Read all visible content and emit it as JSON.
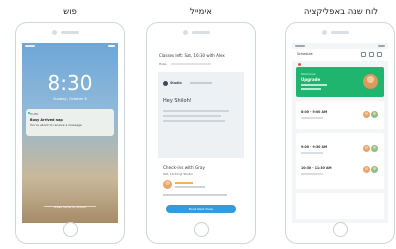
{
  "labels": {
    "app_screen": "לוח שנה באפליקציה",
    "email": "אימייל",
    "push": "פוש"
  },
  "push_phone": {
    "time": "8:30",
    "date": "Sunday, October 8",
    "notification_app": "HUBS",
    "notification_title": "Busy Arrived nap",
    "notification_body": "You're about to receive a message",
    "unlock_text": "Press home to unlock"
  },
  "email_phone": {
    "subject": "Classes left: Sat, 16:30 with Alex",
    "from": "Hubs",
    "brand": "Studio",
    "greeting": "Hey Shiloh!",
    "inner_title": "Check-ins with Gray",
    "inner_sub": "Sat, 16:30 @ Studio",
    "cta": "Book Next Class"
  },
  "app_phone": {
    "title": "Schedule",
    "featured_sub": "Tomorrow",
    "featured_title": "Upgrade",
    "slots": [
      {
        "time": "8:00 - 9:00 AM"
      },
      {
        "time": "9:00 - 9:30 AM"
      },
      {
        "time": "10:30 - 11:30 AM"
      }
    ]
  },
  "colors": {
    "accent_green": "#1fb56f",
    "accent_blue": "#2f9de0"
  }
}
